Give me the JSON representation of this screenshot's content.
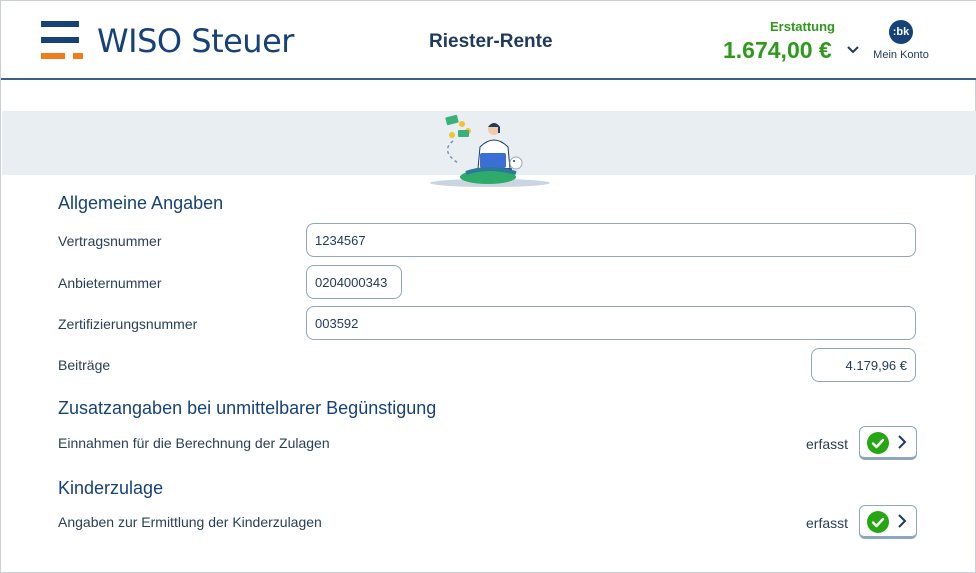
{
  "header": {
    "logo_text": "WISO Steuer",
    "page_title": "Riester-Rente",
    "refund_label": "Erstattung",
    "refund_amount": "1.674,00 €",
    "account_avatar": ":bk",
    "account_label": "Mein Konto"
  },
  "colors": {
    "brand_blue": "#16427a",
    "brand_orange": "#f07d1a",
    "refund_green": "#2e9a1c",
    "check_green": "#27a614"
  },
  "sections": {
    "general": {
      "title": "Allgemeine Angaben",
      "contract_label": "Vertragsnummer",
      "contract_value": "1234567",
      "provider_label": "Anbieternummer",
      "provider_value": "0204000343",
      "cert_label": "Zertifizierungsnummer",
      "cert_value": "003592",
      "contrib_label": "Beiträge",
      "contrib_value": "4.179,96 €"
    },
    "supplementary": {
      "title": "Zusatzangaben bei unmittelbarer Begünstigung",
      "income_label": "Einnahmen für die Berechnung der Zulagen",
      "income_status": "erfasst"
    },
    "child": {
      "title": "Kinderzulage",
      "child_label": "Angaben zur Ermittlung der Kinderzulagen",
      "child_status": "erfasst"
    }
  },
  "icons": {
    "status_check": "check-circle-icon",
    "open": "chevron-right-icon",
    "dropdown": "chevron-down-icon"
  }
}
